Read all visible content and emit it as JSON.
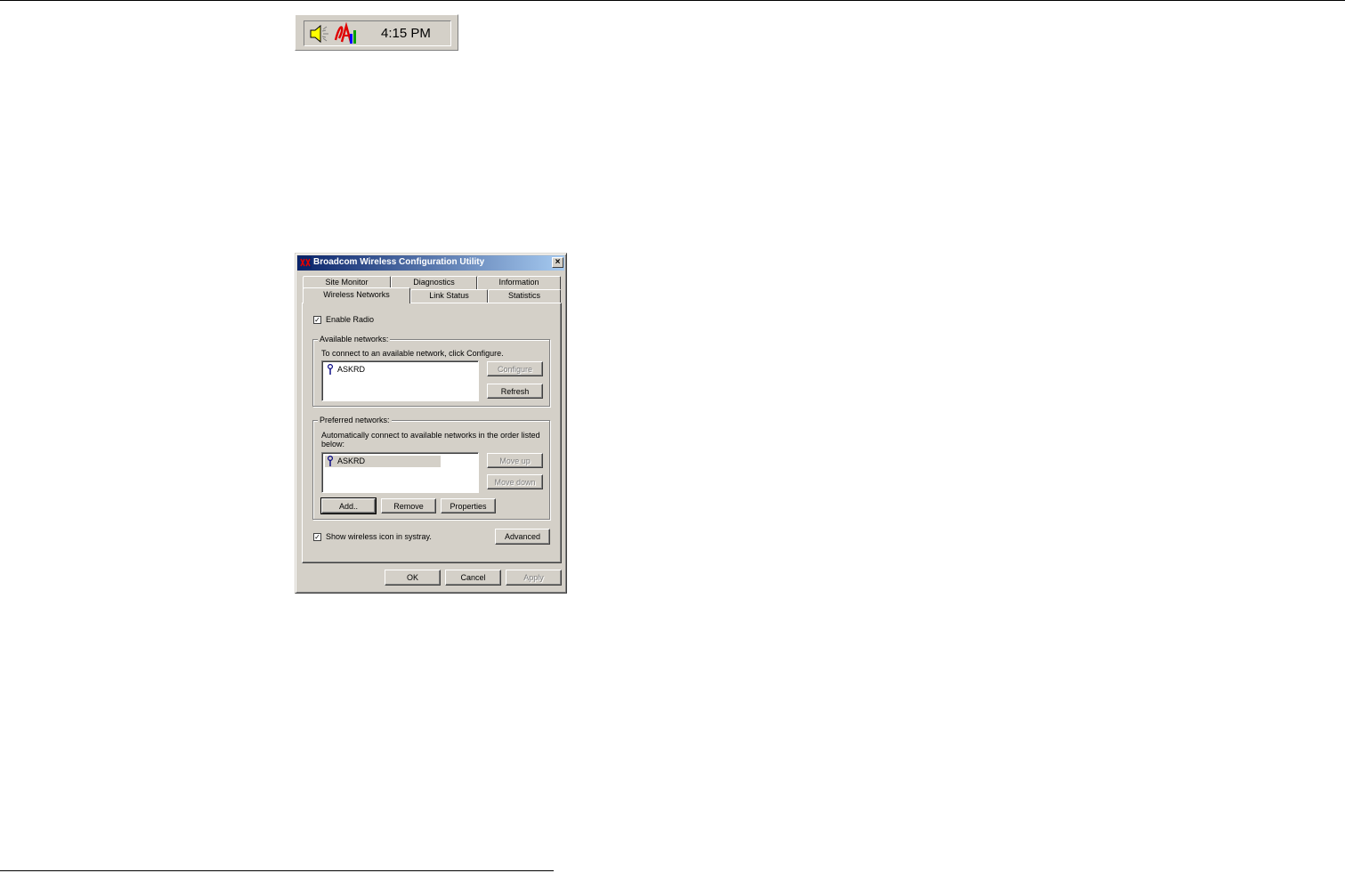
{
  "tray": {
    "icons": [
      "speaker-icon",
      "wireless-utility-icon"
    ],
    "clock": "4:15 PM"
  },
  "dialog": {
    "title": "Broadcom Wireless Configuration Utility",
    "close_label": "×",
    "tabs_back": [
      "Site Monitor",
      "Diagnostics",
      "Information"
    ],
    "tabs_front": [
      "Wireless Networks",
      "Link Status",
      "Statistics"
    ],
    "active_tab": "Wireless Networks",
    "enable_radio": {
      "label": "Enable Radio",
      "checked": true,
      "mark": "✓"
    },
    "available": {
      "title": "Available networks:",
      "instructions": "To connect to an available network, click Configure.",
      "networks": [
        "ASKRD"
      ],
      "configure_label": "Configure",
      "refresh_label": "Refresh"
    },
    "preferred": {
      "title": "Preferred networks:",
      "instructions_line1": "Automatically connect to available networks in the order listed",
      "instructions_line2": "below:",
      "networks": [
        "ASKRD"
      ],
      "move_up_label": "Move up",
      "move_down_label": "Move down",
      "add_label": "Add..",
      "remove_label": "Remove",
      "properties_label": "Properties"
    },
    "show_icon": {
      "label": "Show wireless icon in systray.",
      "checked": true,
      "mark": "✓"
    },
    "advanced_label": "Advanced",
    "ok_label": "OK",
    "cancel_label": "Cancel",
    "apply_label": "Apply"
  },
  "colors": {
    "face": "#d4d0c8",
    "title_start": "#0a246a",
    "title_end": "#a6caf0",
    "disabled_text": "#808080"
  }
}
